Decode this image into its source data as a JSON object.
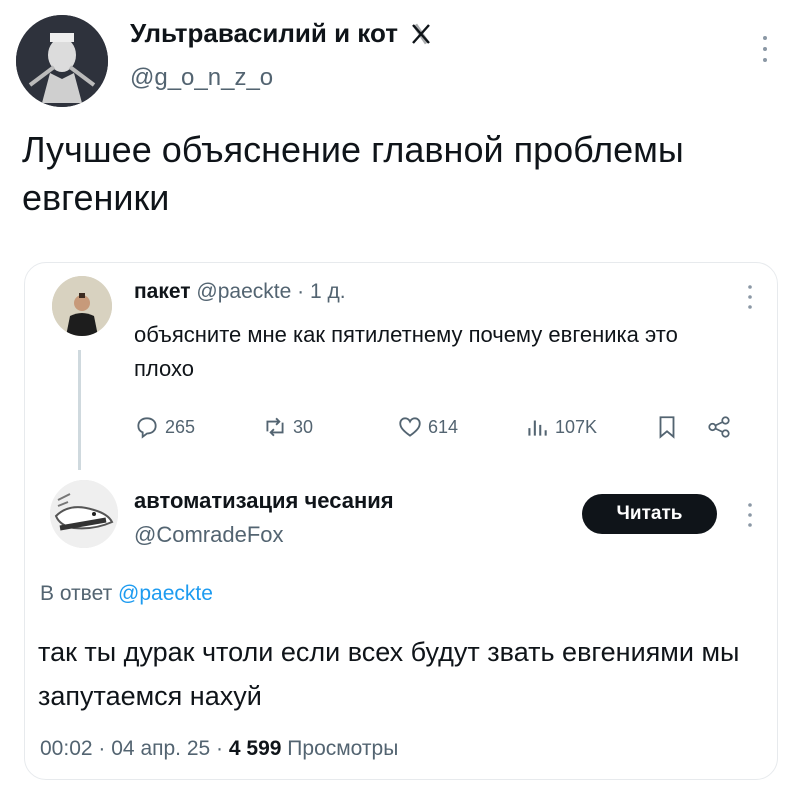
{
  "outer_tweet": {
    "display_name": "Ультравасилий и кот",
    "badge_icon": "x-logo-icon",
    "handle": "@g_o_n_z_o",
    "text": "Лучшее объяснение главной проблемы евгеники"
  },
  "quoted_tweet": {
    "display_name": "пакет",
    "handle": "@paeckte",
    "separator": "·",
    "age": "1 д.",
    "text": "объясните мне как пятилетнему почему евгеника это плохо",
    "actions": {
      "replies": "265",
      "retweets": "30",
      "likes": "614",
      "views": "107K"
    }
  },
  "reply_tweet": {
    "display_name": "автоматизация чесания",
    "handle": "@ComradeFox",
    "follow_label": "Читать",
    "reply_prefix": "В ответ",
    "reply_handle": "@paeckte",
    "text": "так ты дурак чтоли если всех будут звать евгениями мы запутаемся нахуй",
    "time": "00:02",
    "sep1": "·",
    "date": "04 апр. 25",
    "sep2": "·",
    "views_count": "4 599",
    "views_label": "Просмотры"
  },
  "colors": {
    "text": "#0f1419",
    "muted": "#536471",
    "link": "#1d9bf0",
    "button_bg": "#0f1419",
    "border": "#e7eaed"
  }
}
